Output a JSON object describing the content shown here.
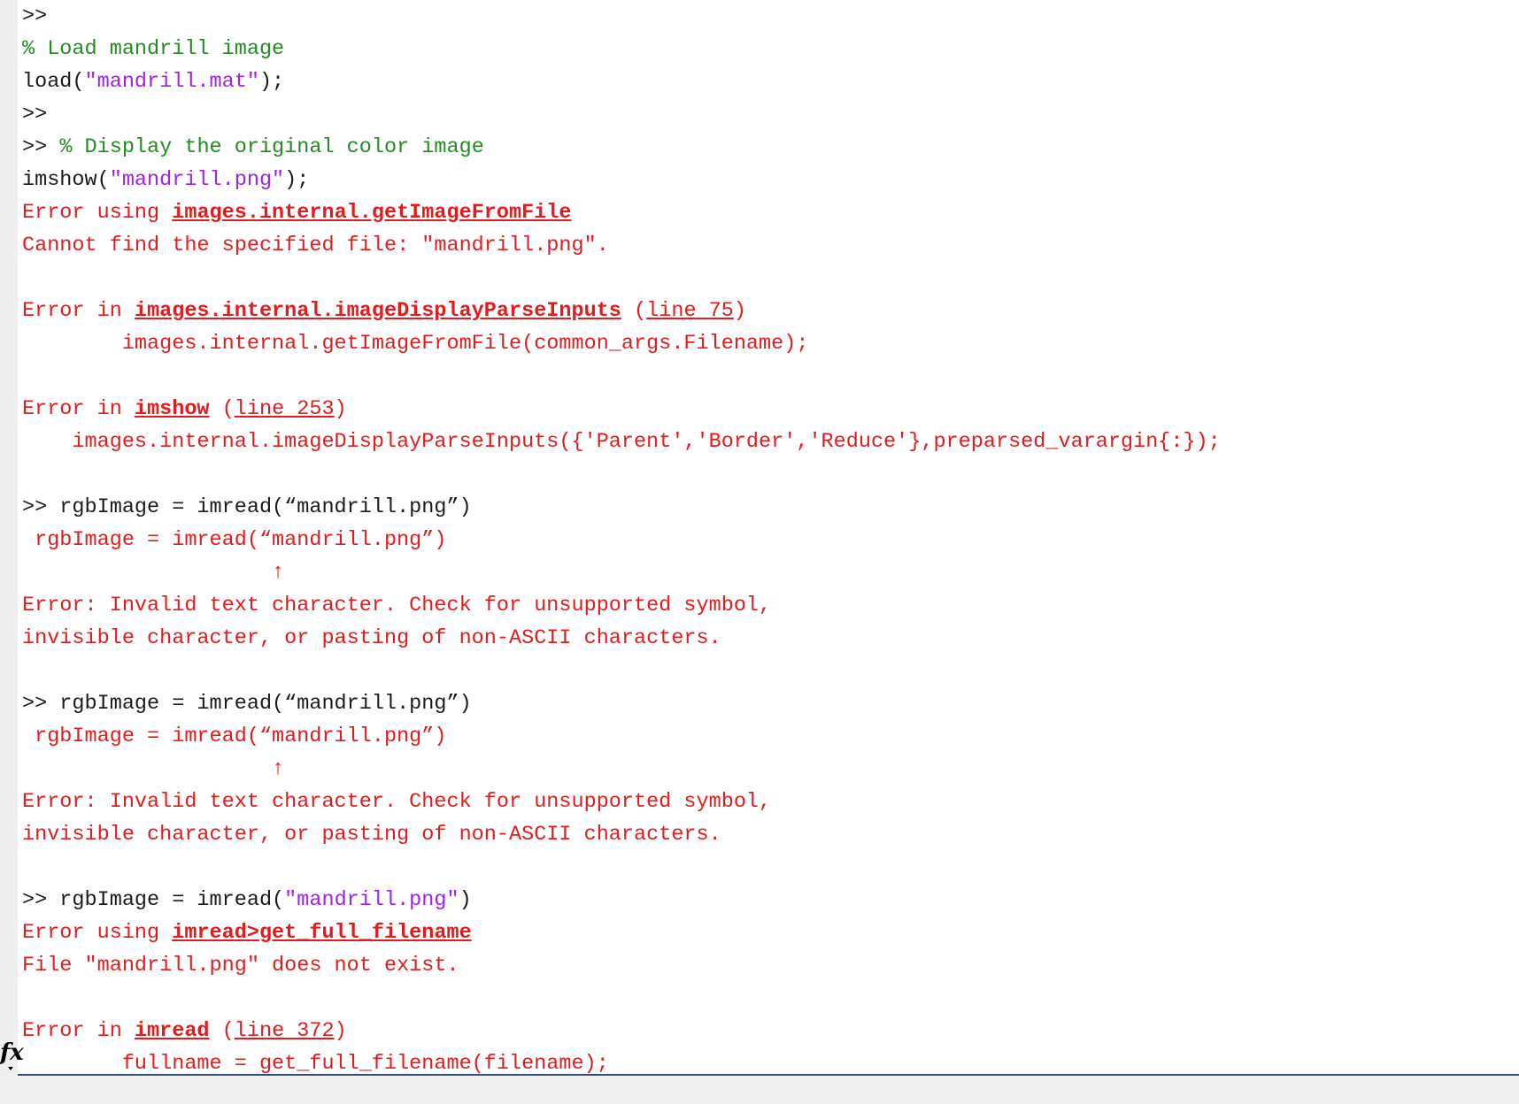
{
  "console": {
    "l1_prompt": ">>",
    "l2_comment": "% Load mandrill image",
    "l3_a": "load(",
    "l3_str": "\"mandrill.mat\"",
    "l3_b": ");",
    "l4_prompt": ">>",
    "l5_prompt": ">> ",
    "l5_comment": "% Display the original color image",
    "l6_a": "imshow(",
    "l6_str": "\"mandrill.png\"",
    "l6_b": ");",
    "l7_text": "Error using ",
    "l7_link": "images.internal.getImageFromFile",
    "l8_text": "Cannot find the specified file: \"mandrill.png\".",
    "l10_text": "Error in ",
    "l10_link": "images.internal.imageDisplayParseInputs",
    "l10_sp": " (",
    "l10_line": "line 75",
    "l10_close": ")",
    "l11_text": "        images.internal.getImageFromFile(common_args.Filename);",
    "l13_text": "Error in ",
    "l13_link": "imshow",
    "l13_sp": " (",
    "l13_line": "line 253",
    "l13_close": ")",
    "l14_text": "    images.internal.imageDisplayParseInputs({'Parent','Border','Reduce'},preparsed_varargin{:});",
    "l16_cmd": ">> rgbImage = imread(“mandrill.png”)",
    "l17_echo": " rgbImage = imread(“mandrill.png”)",
    "l18_caret": "                    ↑",
    "l19_err": "Error: Invalid text character. Check for unsupported symbol,",
    "l20_err": "invisible character, or pasting of non-ASCII characters.",
    "l22_cmd": ">> rgbImage = imread(“mandrill.png”)",
    "l23_echo": " rgbImage = imread(“mandrill.png”)",
    "l24_caret": "                    ↑",
    "l25_err": "Error: Invalid text character. Check for unsupported symbol,",
    "l26_err": "invisible character, or pasting of non-ASCII characters.",
    "l28_a": ">> rgbImage = imread(",
    "l28_str": "\"mandrill.png\"",
    "l28_b": ")",
    "l29_text": "Error using ",
    "l29_link": "imread>get_full_filename",
    "l30_text": "File \"mandrill.png\" does not exist.",
    "l32_text": "Error in ",
    "l32_link": "imread",
    "l32_sp": " (",
    "l32_line": "line 372",
    "l32_close": ")",
    "l33_text": "        fullname = get_full_filename(filename);"
  },
  "fx_label": "fx",
  "colors": {
    "comment": "#228b22",
    "string": "#a020f0",
    "error": "#e41a1c",
    "text": "#1a1a1a"
  }
}
